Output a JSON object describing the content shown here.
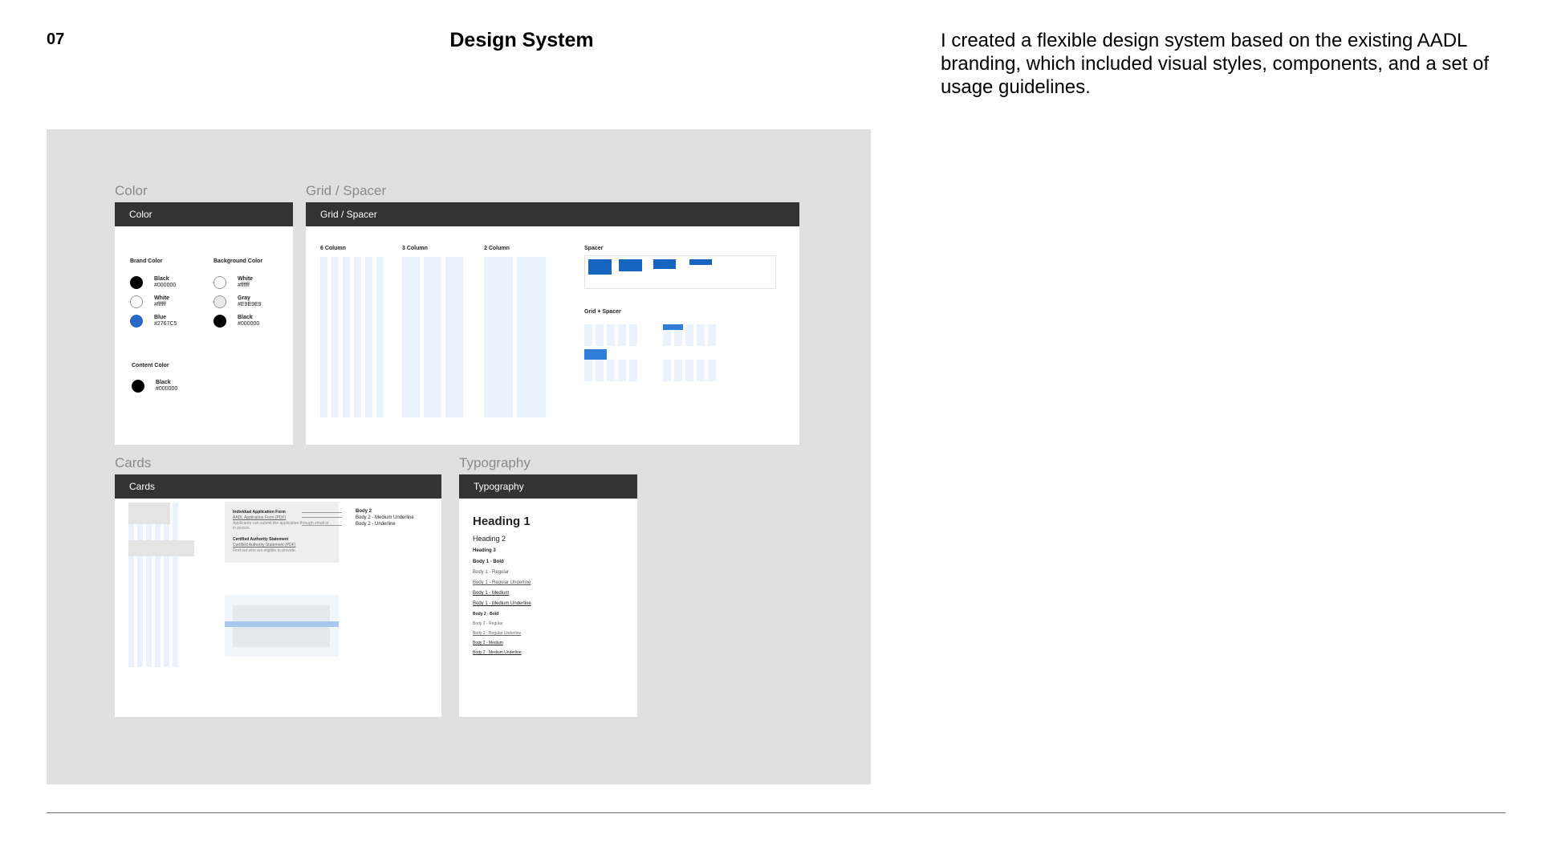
{
  "page": {
    "number": "07",
    "title": "Design System",
    "description": "I created a flexible design system based on the existing AADL branding, which included visual styles, components, and a set of usage guidelines."
  },
  "colors": {
    "brand_blue": "#2767C5",
    "dark_header": "#333333",
    "showcase_bg": "#E0E0E0",
    "grid_tint": "#EAF3FD"
  },
  "sections": {
    "color": {
      "label": "Color",
      "header": "Color",
      "brand_title": "Brand Color",
      "brand": [
        {
          "name": "Black",
          "hex": "#000000"
        },
        {
          "name": "White",
          "hex": "#ffffff"
        },
        {
          "name": "Blue",
          "hex": "#2767C5"
        }
      ],
      "background_title": "Background Color",
      "background": [
        {
          "name": "White",
          "hex": "#ffffff"
        },
        {
          "name": "Gray",
          "hex": "#E9E9E9"
        },
        {
          "name": "Black",
          "hex": "#000000"
        }
      ],
      "content_title": "Content Color",
      "content": [
        {
          "name": "Black",
          "hex": "#000000"
        }
      ]
    },
    "grid": {
      "label": "Grid / Spacer",
      "header": "Grid / Spacer",
      "six_column": "6 Column",
      "three_column": "3 Column",
      "two_column": "2 Column",
      "spacer": "Spacer",
      "grid_spacer": "Grid + Spacer"
    },
    "cards": {
      "label": "Cards",
      "header": "Cards",
      "form_title": "Individual Application Form",
      "form_link": "AADL Application Form (PDF)",
      "form_note": "Applicants can submit the application through email or in person.",
      "statement_title": "Certified Authority Statement",
      "statement_link": "Certified Authority Statement (PDF)",
      "statement_note": "Find out who are eligible to provide.",
      "annotations": [
        "Body 2",
        "Body 2 - Medium Underline",
        "Body 2 - Underline"
      ]
    },
    "typography": {
      "label": "Typography",
      "header": "Typography",
      "heading1": "Heading 1",
      "heading2": "Heading 2",
      "heading3": "Heading 3",
      "body": [
        "Body 1 - Bold",
        "Body 1 - Regular",
        "Body 1 - Regular Underline",
        "Body 1 - Medium",
        "Body 1 - Medium Underline",
        "Body 2 - Bold",
        "Body 2 - Regular",
        "Body 2 - Regular Underline",
        "Body 2 - Medium",
        "Body 2 - Medium Underline"
      ]
    }
  }
}
